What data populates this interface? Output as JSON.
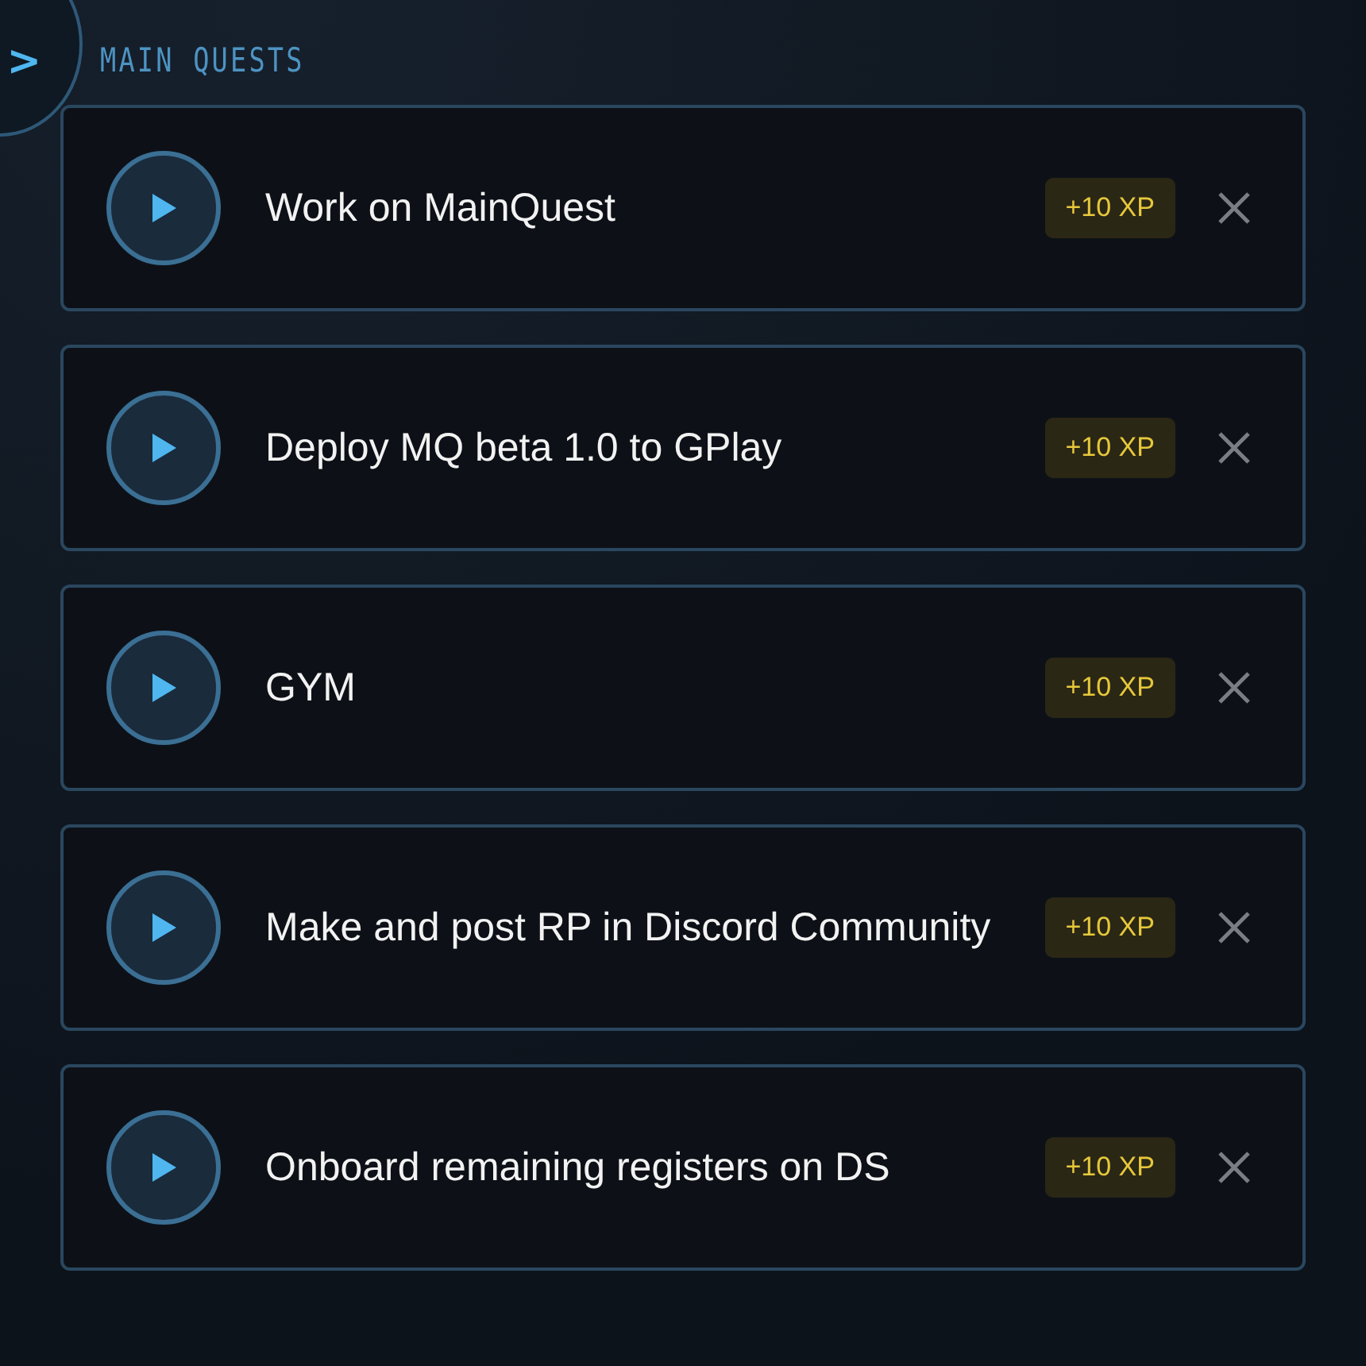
{
  "toggle": {
    "glyph": ">"
  },
  "section": {
    "title": "MAIN QUESTS"
  },
  "quests": [
    {
      "title": "Work on MainQuest",
      "xp": "+10 XP"
    },
    {
      "title": "Deploy MQ beta 1.0 to GPlay",
      "xp": "+10 XP"
    },
    {
      "title": "GYM",
      "xp": "+10 XP"
    },
    {
      "title": "Make and post RP in Discord Community",
      "xp": "+10 XP"
    },
    {
      "title": "Onboard remaining registers on DS",
      "xp": "+10 XP"
    }
  ]
}
